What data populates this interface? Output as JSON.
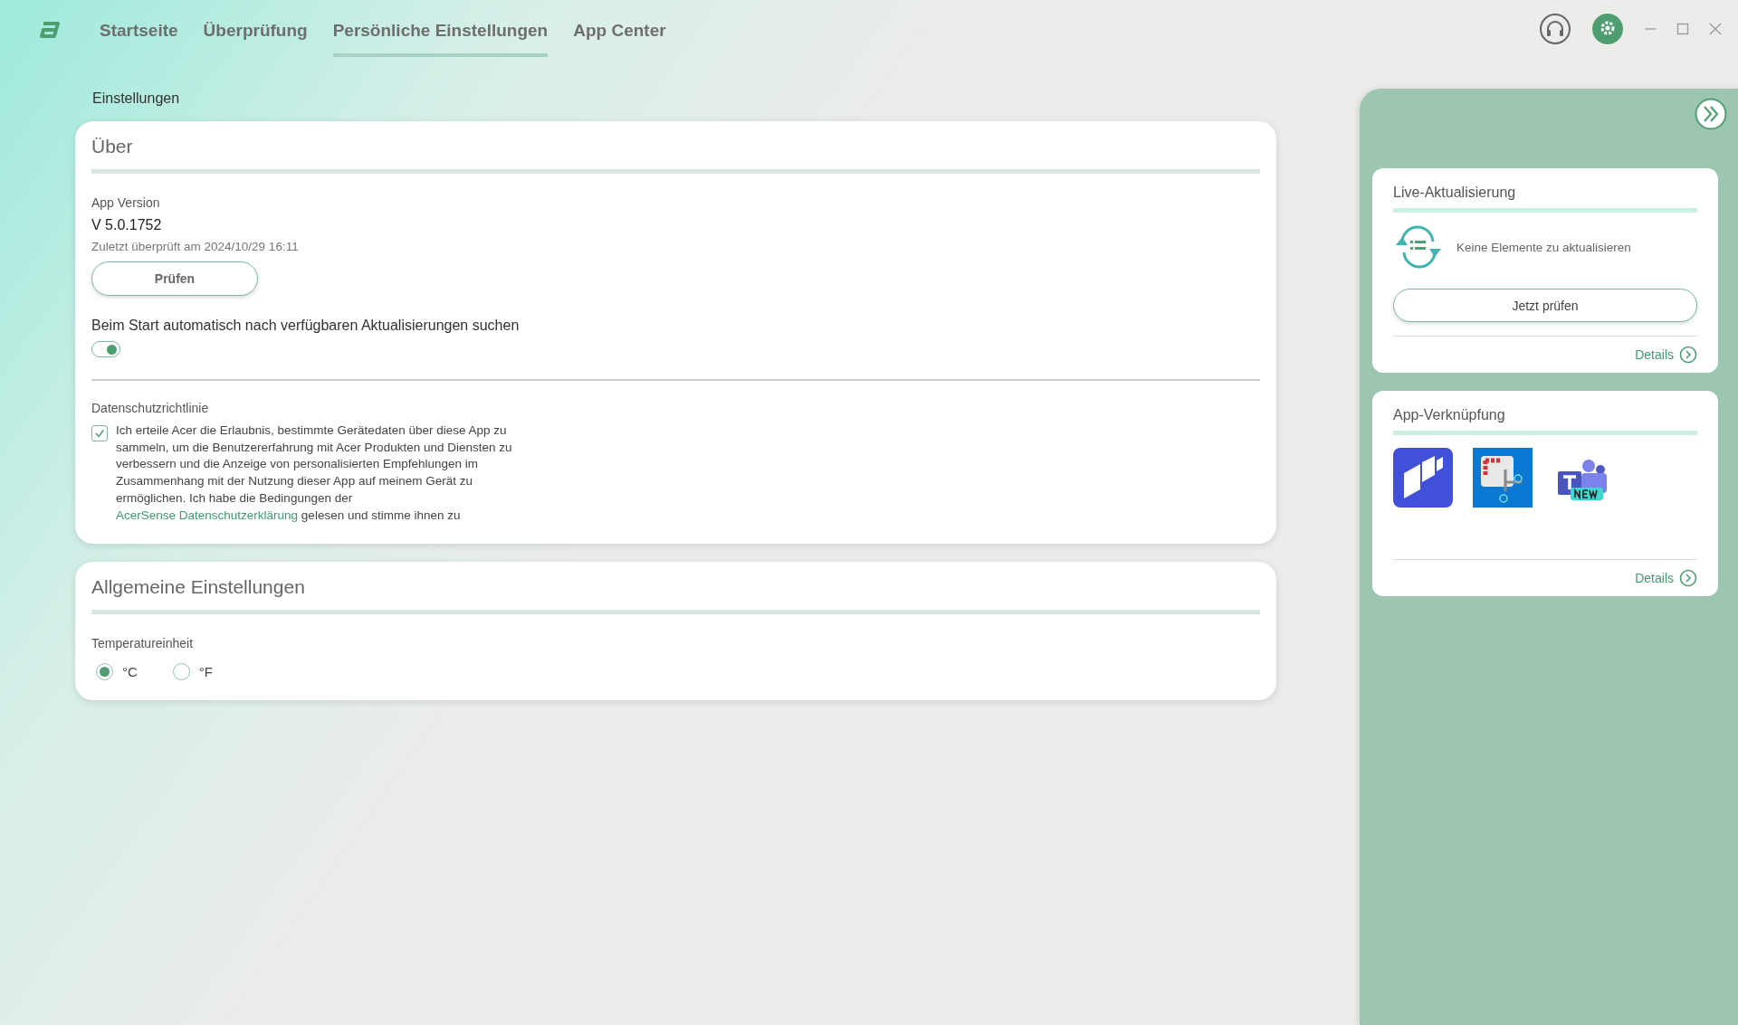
{
  "nav": {
    "tabs": [
      {
        "label": "Startseite",
        "selected": false
      },
      {
        "label": "Überprüfung",
        "selected": false
      },
      {
        "label": "Persönliche Einstellungen",
        "selected": true
      },
      {
        "label": "App Center",
        "selected": false
      }
    ]
  },
  "page_title": "Einstellungen",
  "about": {
    "title": "Über",
    "version_label": "App Version",
    "version": "V 5.0.1752",
    "last_checked": "Zuletzt überprüft am 2024/10/29 16:11",
    "check_button": "Prüfen",
    "auto_update": {
      "label": "Beim Start automatisch nach verfügbaren Aktualisierungen suchen",
      "on": true
    },
    "privacy": {
      "label": "Datenschutzrichtlinie",
      "checked": true,
      "text": "Ich erteile Acer die Erlaubnis, bestimmte Gerätedaten über diese App zu sammeln, um die Benutzererfahrung mit Acer Produkten und Diensten zu verbessern und die Anzeige von personalisierten Empfehlungen im Zusammenhang mit der Nutzung dieser App auf meinem Gerät zu ermöglichen. Ich habe die Bedingungen der",
      "link": "AcerSense Datenschutzerklärung",
      "text_after": "gelesen und stimme ihnen zu"
    }
  },
  "general": {
    "title": "Allgemeine Einstellungen",
    "temperature_label": "Temperatureinheit",
    "units": [
      {
        "label": "°C",
        "selected": true
      },
      {
        "label": "°F",
        "selected": false
      }
    ]
  },
  "side_panel": {
    "live_update": {
      "title": "Live-Aktualisierung",
      "status": "Keine Elemente zu aktualisieren",
      "check_button": "Jetzt prüfen",
      "details": "Details"
    },
    "app_links": {
      "title": "App-Verknüpfung",
      "apps": [
        {
          "kind": "blocks"
        },
        {
          "kind": "snip"
        },
        {
          "kind": "teams"
        }
      ],
      "details": "Details"
    }
  }
}
